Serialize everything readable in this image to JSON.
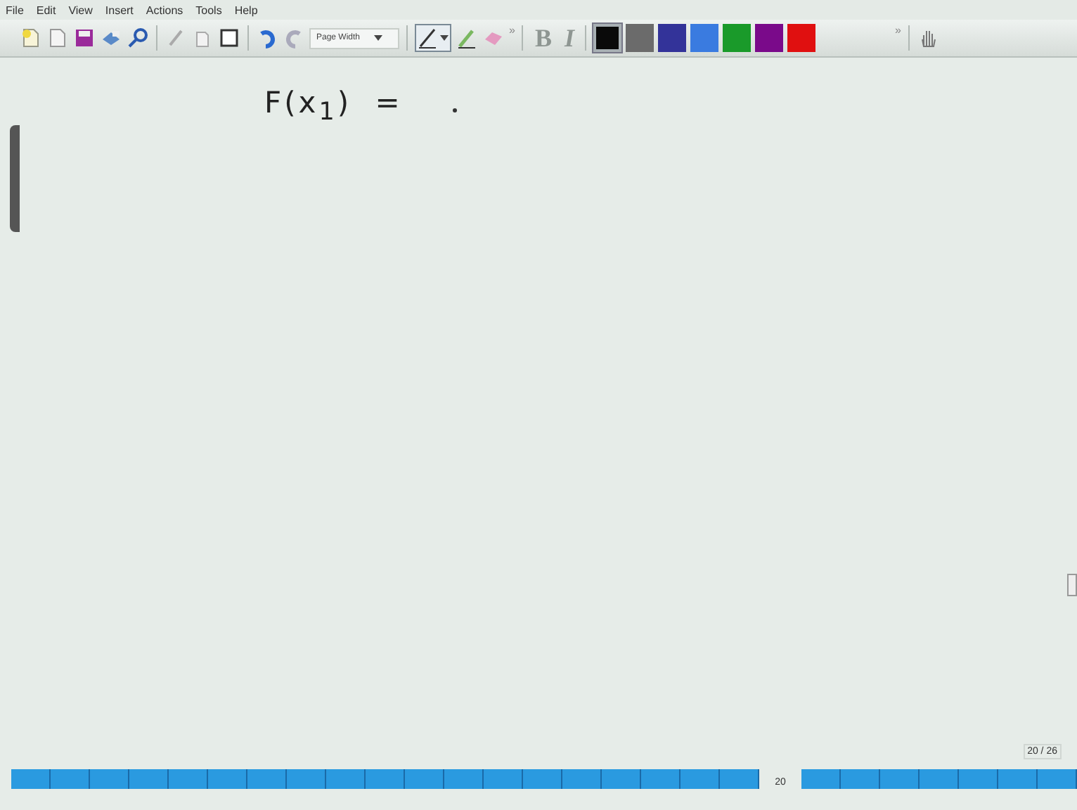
{
  "menu": [
    "File",
    "Edit",
    "View",
    "Insert",
    "Actions",
    "Tools",
    "Help"
  ],
  "toolbar": {
    "zoom": "Page Width",
    "pen_selected": true,
    "bold": {
      "label": "B",
      "disabled": true
    },
    "italic": {
      "label": "I",
      "disabled": true
    },
    "overflow": [
      "»",
      "»"
    ],
    "colors": [
      {
        "color": "#0a0a0a",
        "selected": true
      },
      {
        "color": "#6b6b6b",
        "selected": false
      },
      {
        "color": "#333399",
        "selected": false
      },
      {
        "color": "#3a7be0",
        "selected": false
      },
      {
        "color": "#1a9a2a",
        "selected": false
      },
      {
        "color": "#7a0a8a",
        "selected": false
      },
      {
        "color": "#e01010",
        "selected": false
      }
    ]
  },
  "ink": {
    "text": "F(x$_{1}$) ="
  },
  "page_counter": "20 / 26",
  "page_strip": {
    "current": "20"
  }
}
